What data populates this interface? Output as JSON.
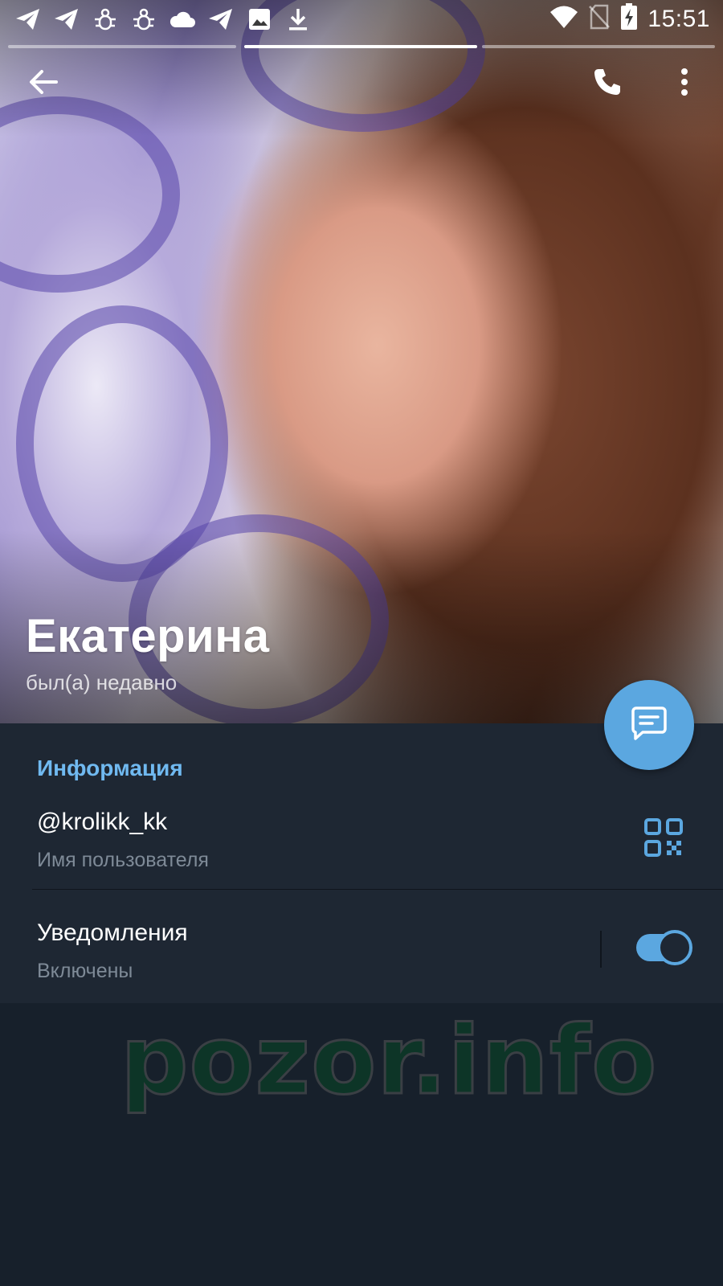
{
  "status_bar": {
    "time": "15:51",
    "notification_icons": [
      "telegram-icon",
      "telegram-icon",
      "bug-icon",
      "bug-icon",
      "cloud-icon",
      "telegram-icon",
      "image-icon",
      "download-icon"
    ],
    "system_icons": [
      "wifi-icon",
      "no-sim-icon",
      "battery-charging-icon"
    ]
  },
  "story": {
    "segments": 3,
    "active_segment": 2
  },
  "toolbar": {
    "back_icon": "arrow-left-icon",
    "call_icon": "phone-icon",
    "menu_icon": "more-vertical-icon"
  },
  "profile": {
    "name": "Екатерина",
    "last_seen": "был(а) недавно",
    "message_icon": "message-icon"
  },
  "info": {
    "section_title": "Информация",
    "username": "@krolikk_kk",
    "username_label": "Имя пользователя",
    "notifications_label": "Уведомления",
    "notifications_state": "Включены",
    "notifications_enabled": true
  },
  "watermark": {
    "text": "pozor.info"
  },
  "colors": {
    "accent": "#5ba7e0",
    "section_title": "#70b9f0",
    "panel_bg": "#1e2733",
    "page_bg": "#17202b",
    "watermark": "#0d3527"
  }
}
